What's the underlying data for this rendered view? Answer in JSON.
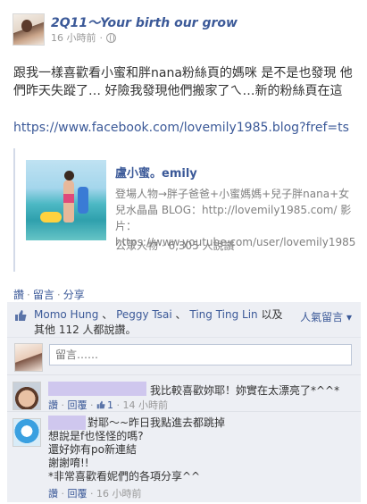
{
  "post": {
    "author": "2Q11～Your birth our grow",
    "time": "16 小時前",
    "text": "跟我一樣喜歡看小蜜和胖nana粉絲頁的媽咪 是不是也發現 他們昨天失蹤了… 好險我發現他們搬家了ㄟ…新的粉絲頁在這",
    "link": "https://www.facebook.com/lovemily1985.blog?fref=ts"
  },
  "share": {
    "name": "盧小蜜。emily",
    "description": "登場人物→胖子爸爸+小蜜媽媽+兒子胖nana+女兒水晶晶 BLOG：http://lovemily1985.com/ 影片：https://www.youtube.com/user/lovemily1985",
    "stat": "公眾人物 · 6,305 人說讚"
  },
  "actions": {
    "like": "讚",
    "comment": "留言",
    "share": "分享",
    "sep": "·"
  },
  "likes": {
    "names": [
      "Momo Hung",
      "Peggy Tsai",
      "Ting Ting Lin"
    ],
    "name_sep": "、",
    "suffix": "以及其他 112 人都說讚。",
    "popular": "人氣留言 ▾"
  },
  "composer": {
    "placeholder": "留言……"
  },
  "comments": [
    {
      "text": "我比較喜歡妳耶！妳實在太漂亮了*^^*",
      "like": "讚",
      "reply": "回覆",
      "like_count": "1",
      "time": "14 小時前",
      "sep": "·"
    },
    {
      "lines": [
        "對耶～~昨日我點進去都跳掉",
        "想說是f也怪怪的嗎?",
        "還好妳有po新連結",
        "謝謝唷!!",
        "*非常喜歡看妮們的各項分享^^"
      ],
      "like": "讚",
      "reply": "回覆",
      "time": "16 小時前",
      "sep": "·"
    }
  ],
  "colors": {
    "link": "#3b5998",
    "feedback_bg": "#edeff4",
    "redaction": "#cfc7ee"
  },
  "icons": {
    "privacy": "globe-icon",
    "like": "thumbs-up-icon"
  }
}
